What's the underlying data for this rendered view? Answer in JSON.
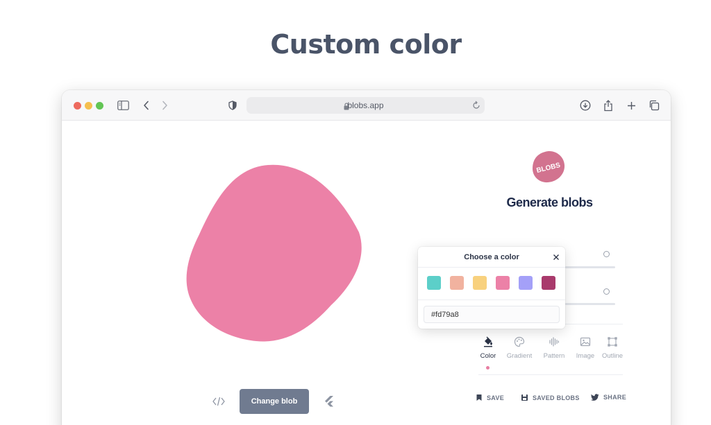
{
  "heading": "Custom color",
  "browser": {
    "url": "blobs.app",
    "icons": [
      "sidebar-icon",
      "back-icon",
      "forward-icon",
      "shield-icon",
      "lock-icon",
      "reload-icon",
      "download-icon",
      "share-icon",
      "plus-icon",
      "tabs-icon"
    ]
  },
  "blob": {
    "color": "#ec81a7"
  },
  "app": {
    "logo_text": "BLOBS",
    "logo_color": "#d2738f",
    "title": "Generate blobs"
  },
  "color_picker": {
    "title": "Choose a color",
    "swatches": [
      {
        "color": "#5ccfc9"
      },
      {
        "color": "#f1b29f"
      },
      {
        "color": "#f8d17e"
      },
      {
        "color": "#ec81a7"
      },
      {
        "color": "#a4a0f8"
      },
      {
        "color": "#a93a6c"
      }
    ],
    "hex_value": "#fd79a8"
  },
  "tabs": [
    {
      "label": "Color",
      "icon": "paint-bucket-icon",
      "active": true
    },
    {
      "label": "Gradient",
      "icon": "palette-icon",
      "active": false
    },
    {
      "label": "Pattern",
      "icon": "pattern-icon",
      "active": false
    },
    {
      "label": "Image",
      "icon": "image-icon",
      "active": false
    },
    {
      "label": "Outline",
      "icon": "outline-icon",
      "active": false
    }
  ],
  "footer": {
    "change_blob_label": "Change blob",
    "save_label": "SAVE",
    "saved_blobs_label": "SAVED BLOBS",
    "share_label": "SHARE"
  }
}
